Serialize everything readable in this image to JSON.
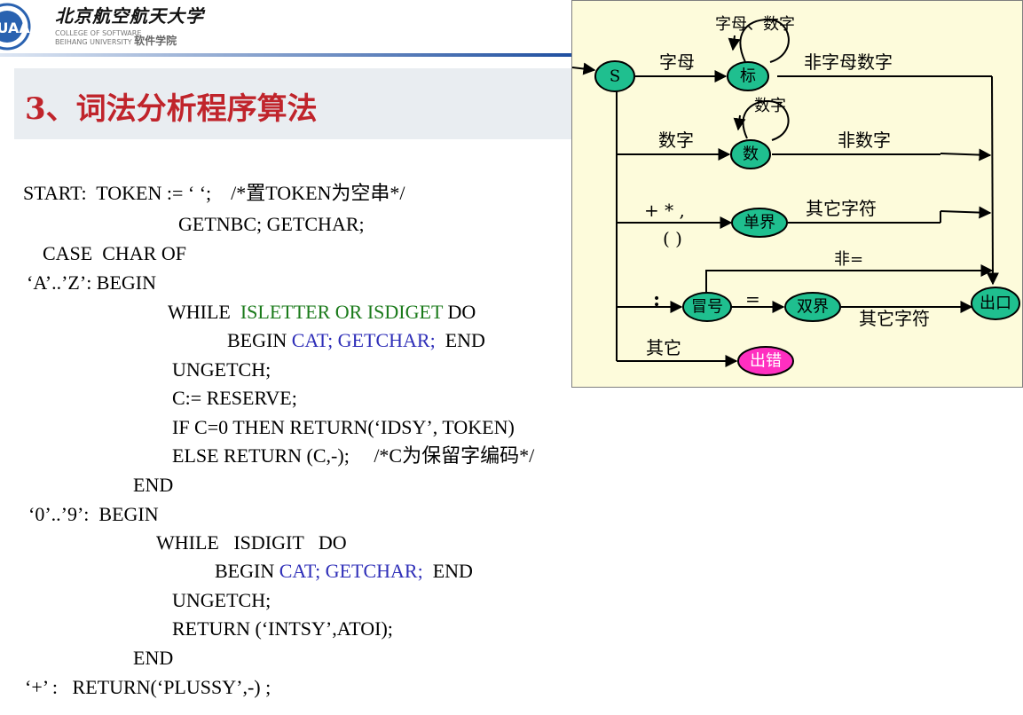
{
  "header": {
    "university": "北京航空航天大学",
    "college_en_1": "COLLEGE OF SOFTWARE",
    "college_en_2": "BEIHANG UNIVERSITY",
    "college_cn": "软件学院",
    "logo_text": "BUAA"
  },
  "title": "3、词法分析程序算法",
  "code_lines": [
    {
      "id": "l1",
      "parts": [
        {
          "t": "START:  TOKEN := ‘ ‘;    /*置TOKEN为空串*/"
        }
      ]
    },
    {
      "id": "l2",
      "parts": [
        {
          "t": "GETNBC; GETCHAR;"
        }
      ]
    },
    {
      "id": "l3",
      "parts": [
        {
          "t": "CASE  CHAR OF"
        }
      ]
    },
    {
      "id": "l4",
      "parts": [
        {
          "t": "‘A’..’Z’: BEGIN"
        }
      ]
    },
    {
      "id": "l5",
      "parts": [
        {
          "t": "WHILE  "
        },
        {
          "t": "ISLETTER OR ISDIGET",
          "c": "g"
        },
        {
          "t": " DO"
        }
      ]
    },
    {
      "id": "l6",
      "parts": [
        {
          "t": "BEGIN "
        },
        {
          "t": "CAT; GETCHAR;",
          "c": "b"
        },
        {
          "t": "  END"
        }
      ]
    },
    {
      "id": "l7",
      "parts": [
        {
          "t": "UNGETCH;"
        }
      ]
    },
    {
      "id": "l8",
      "parts": [
        {
          "t": "C:= RESERVE;"
        }
      ]
    },
    {
      "id": "l9",
      "parts": [
        {
          "t": "IF C=0 THEN RETURN(‘IDSY’, TOKEN)"
        }
      ]
    },
    {
      "id": "l10",
      "parts": [
        {
          "t": "ELSE RETURN (C,-);     /*C为保留字编码*/"
        }
      ]
    },
    {
      "id": "l11",
      "parts": [
        {
          "t": "END"
        }
      ]
    },
    {
      "id": "l12",
      "parts": [
        {
          "t": "‘0’..’9’:  BEGIN"
        }
      ]
    },
    {
      "id": "l13",
      "parts": [
        {
          "t": "WHILE   ISDIGIT   DO"
        }
      ]
    },
    {
      "id": "l14",
      "parts": [
        {
          "t": "BEGIN "
        },
        {
          "t": "CAT; GETCHAR;",
          "c": "b"
        },
        {
          "t": "  END"
        }
      ]
    },
    {
      "id": "l15",
      "parts": [
        {
          "t": "UNGETCH;"
        }
      ]
    },
    {
      "id": "l16",
      "parts": [
        {
          "t": "RETURN (‘INTSY’,ATOI);"
        }
      ]
    },
    {
      "id": "l17",
      "parts": [
        {
          "t": "END"
        }
      ]
    },
    {
      "id": "l18",
      "parts": [
        {
          "t": "‘+’ :   RETURN(‘PLUSSY’,-) ;"
        }
      ]
    }
  ],
  "diagram": {
    "nodes": {
      "s": "S",
      "id": "标",
      "num": "数",
      "delim": "单界",
      "colon": "冒号",
      "double": "双界",
      "exit": "出口",
      "error": "出错"
    },
    "edges": {
      "letter_digit_loop": "字母、数字",
      "letter": "字母",
      "not_letter_digit": "非字母数字",
      "digit_loop": "数字",
      "digit": "数字",
      "not_digit": "非数字",
      "delims_row1": "+  *  ,",
      "delims_row2": "(   )",
      "other_char_1": "其它字符",
      "colon_sym": ":",
      "not_eq": "非=",
      "eq": "=",
      "other_char_2": "其它字符",
      "other": "其它"
    },
    "colors": {
      "node_fill": "#1fbf8f",
      "error_fill": "#ff2fc0",
      "panel_bg": "#fdfbdb"
    }
  }
}
